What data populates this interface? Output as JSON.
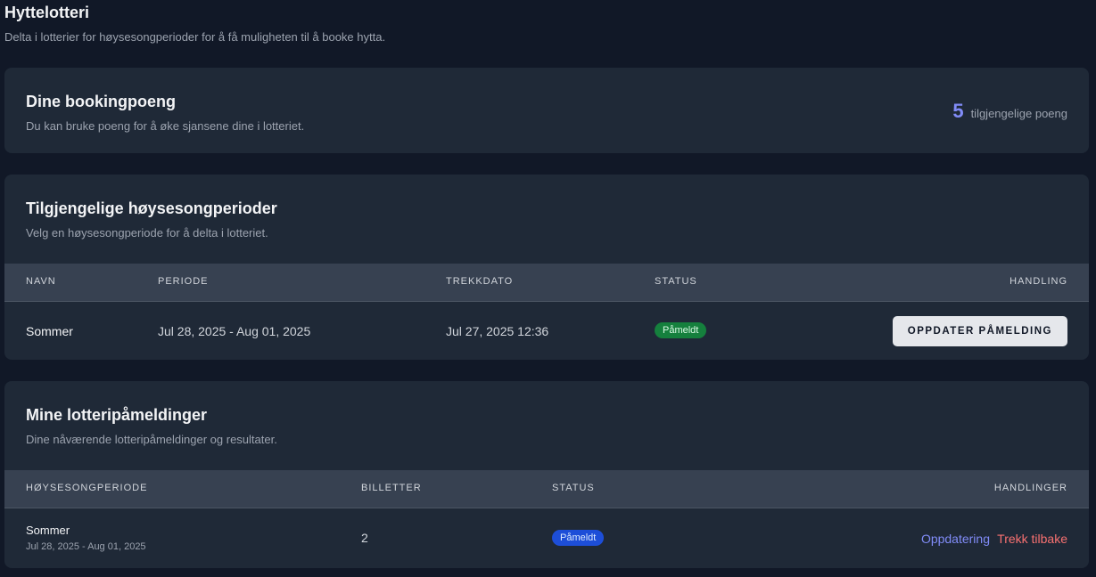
{
  "page": {
    "title": "Hyttelotteri",
    "subtitle": "Delta i lotterier for høysesongperioder for å få muligheten til å booke hytta."
  },
  "points": {
    "title": "Dine bookingpoeng",
    "description": "Du kan bruke poeng for å øke sjansene dine i lotteriet.",
    "value": "5",
    "label": "tilgjengelige poeng"
  },
  "periods": {
    "title": "Tilgjengelige høysesongperioder",
    "description": "Velg en høysesongperiode for å delta i lotteriet.",
    "columns": [
      "Navn",
      "Periode",
      "Trekkdato",
      "Status",
      "Handling"
    ],
    "rows": [
      {
        "name": "Sommer",
        "period": "Jul 28, 2025 - Aug 01, 2025",
        "draw_date": "Jul 27, 2025 12:36",
        "status": "Påmeldt",
        "action": "Oppdater påmelding"
      }
    ]
  },
  "entries": {
    "title": "Mine lotteripåmeldinger",
    "description": "Dine nåværende lotteripåmeldinger og resultater.",
    "columns": [
      "Høysesongperiode",
      "Billetter",
      "Status",
      "Handlinger"
    ],
    "rows": [
      {
        "period_name": "Sommer",
        "period_dates": "Jul 28, 2025 - Aug 01, 2025",
        "tickets": "2",
        "status": "Påmeldt",
        "update_label": "Oppdatering",
        "withdraw_label": "Trekk tilbake"
      }
    ]
  },
  "colors": {
    "background": "#111827",
    "card": "#1f2937",
    "table_header": "#374151",
    "accent": "#818cf8",
    "status_green": "#15803d",
    "status_blue": "#1d4ed8",
    "danger": "#f87171"
  }
}
